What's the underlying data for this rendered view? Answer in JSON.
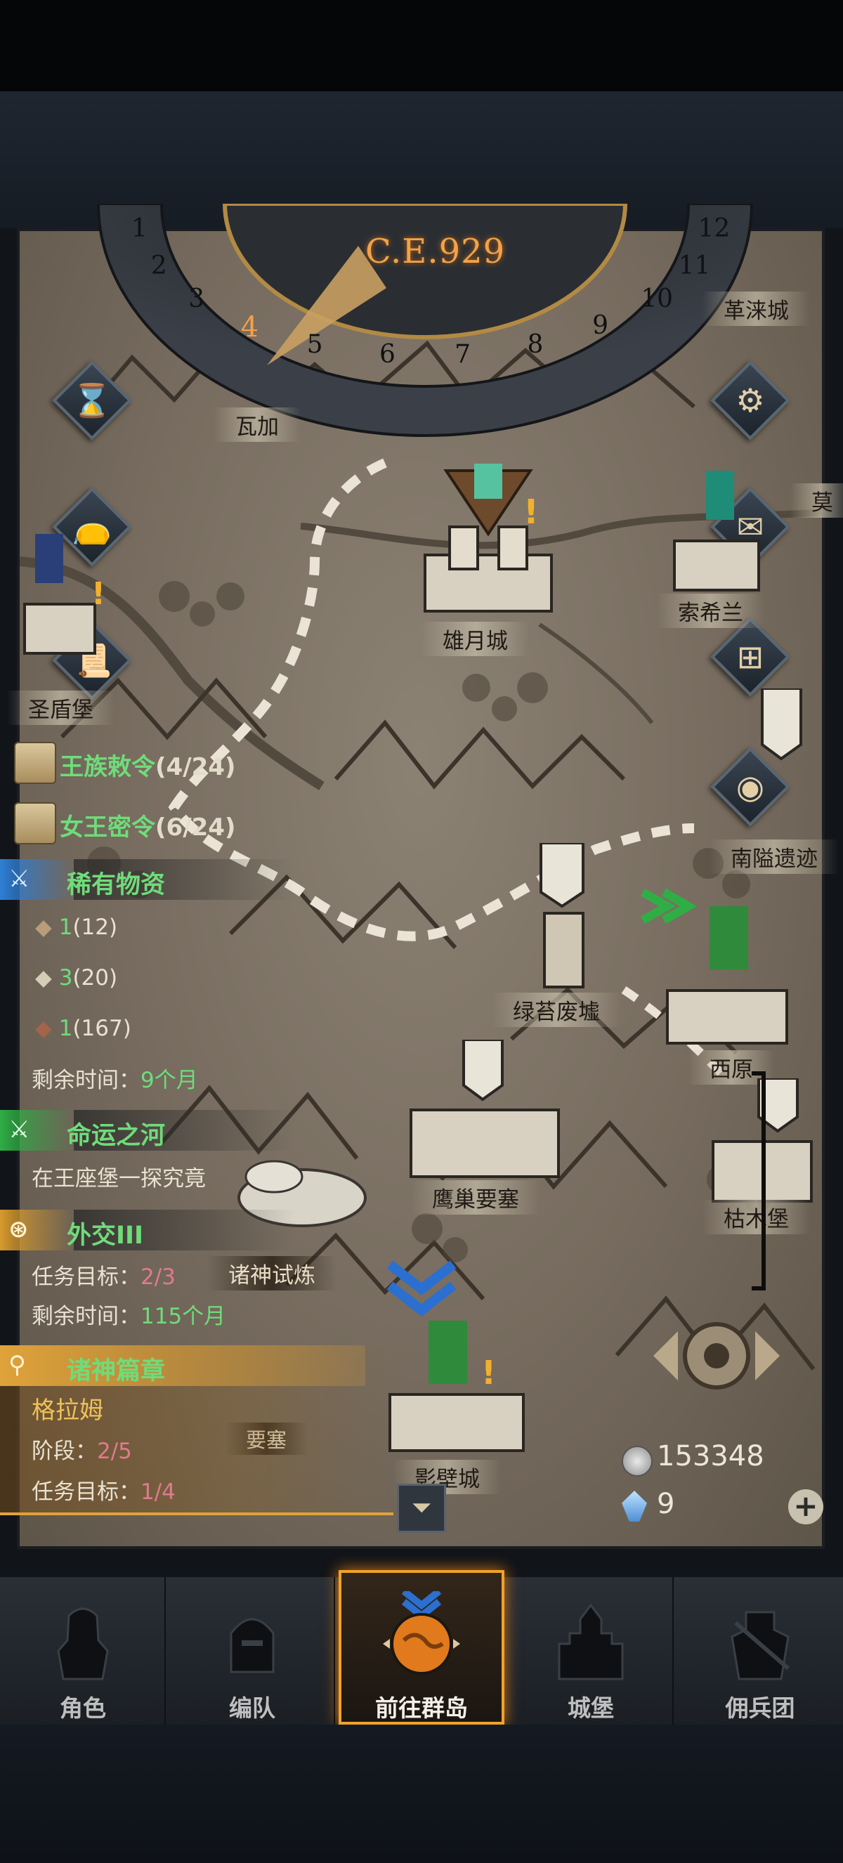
{
  "calendar": {
    "year": "C.E.929",
    "months": [
      "1",
      "2",
      "3",
      "4",
      "5",
      "6",
      "7",
      "8",
      "9",
      "10",
      "11",
      "12"
    ],
    "current_month": "4"
  },
  "cities": {
    "xiongyue": "雄月城",
    "suoxi": "索希兰",
    "shengdun": "圣盾堡",
    "gelai": "革涞城",
    "mo": "莫",
    "wa": "瓦加",
    "nanshi": "南隘遗迹",
    "lvtai": "绿苔废墟",
    "xiyuan": "西原",
    "yingchao": "鹰巢要塞",
    "kumu": "枯木堡",
    "zhushen_label": "诸神试炼",
    "yingbi": "影壁城",
    "yaosai2": "要塞"
  },
  "quests": {
    "royal_decree": {
      "name": "王族敕令",
      "count": "(4/24)"
    },
    "queen_order": {
      "name": "女王密令",
      "count": "(6/24)"
    },
    "rare": {
      "title": "稀有物资",
      "items": [
        {
          "qty": "1",
          "total": "(12)"
        },
        {
          "qty": "3",
          "total": "(20)"
        },
        {
          "qty": "1",
          "total": "(167)"
        }
      ],
      "remaining_label": "剩余时间：",
      "remaining_value": "9个月"
    },
    "fate": {
      "title": "命运之河",
      "desc": "在王座堡一探究竟"
    },
    "diplomacy": {
      "title": "外交III",
      "goal_label": "任务目标：",
      "goal_value": "2/3",
      "remaining_label": "剩余时间：",
      "remaining_value": "115个月"
    },
    "gods": {
      "title": "诸神篇章",
      "hero": "格拉姆",
      "stage_label": "阶段：",
      "stage_value": "2/5",
      "goal_label": "任务目标：",
      "goal_value": "1/4"
    }
  },
  "currency": {
    "silver": "153348",
    "crystal": "9"
  },
  "nav": [
    {
      "label": "角色",
      "icon": "knight-icon"
    },
    {
      "label": "编队",
      "icon": "helmet-icon"
    },
    {
      "label": "前往群岛",
      "icon": "globe-icon"
    },
    {
      "label": "城堡",
      "icon": "castle-icon"
    },
    {
      "label": "佣兵团",
      "icon": "mercenary-icon"
    }
  ],
  "colors": {
    "accent": "#f0a22a",
    "green": "#6fdc7a",
    "pink": "#e07a8d",
    "gold_year": "#f2a24a"
  }
}
